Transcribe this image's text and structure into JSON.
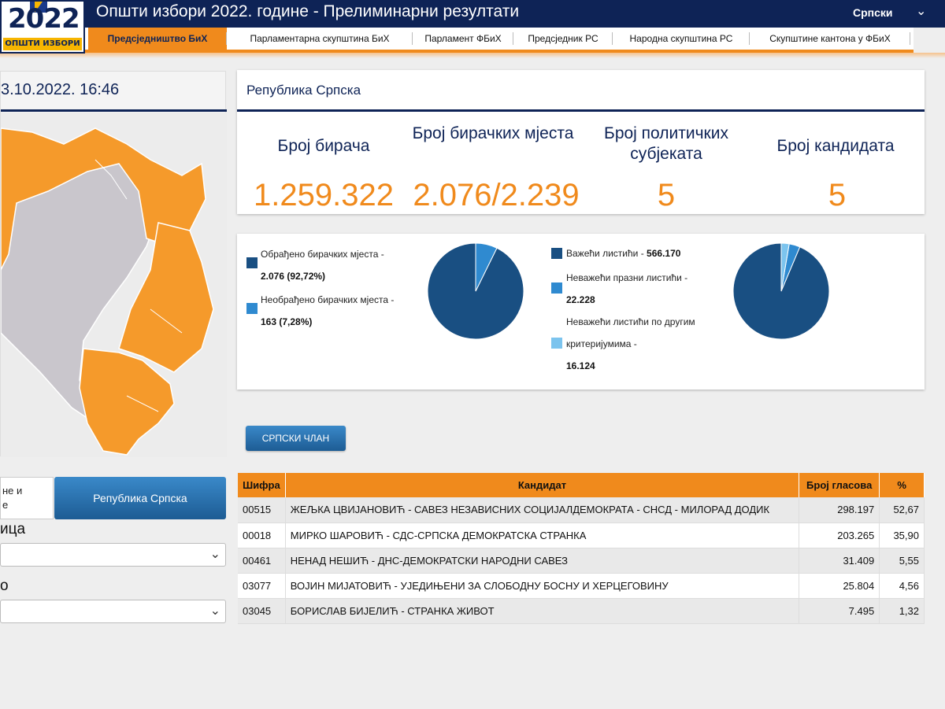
{
  "header": {
    "app_title": "Општи избори 2022. године - Прелиминарни резултати",
    "language": "Српски",
    "logo_year": "2022",
    "logo_caption": "ОПШТИ ИЗБОРИ"
  },
  "nav": {
    "tabs": [
      {
        "label": "Предсједништво БиХ"
      },
      {
        "label": "Парламентарна скупштина БиХ"
      },
      {
        "label": "Парламент ФБиХ"
      },
      {
        "label": "Предсједник РС"
      },
      {
        "label": "Народна скупштина РС"
      },
      {
        "label": "Скупштине кантона у ФБиХ"
      }
    ]
  },
  "left": {
    "datetime": "3.10.2022. 16:46",
    "entity_buttons": [
      "не и\nе",
      "Република Српска"
    ],
    "filter1_label": "ица",
    "filter2_label": "о"
  },
  "stats": {
    "title": "Република Српска",
    "items": [
      {
        "label": "Број бирача",
        "value": "1.259.322"
      },
      {
        "label": "Број бирачких мјеста",
        "value": "2.076/2.239"
      },
      {
        "label": "Број политичких субјеката",
        "value": "5"
      },
      {
        "label": "Број кандидата",
        "value": "5"
      }
    ]
  },
  "pies": {
    "left_legend": [
      {
        "text": "Обрађено бирачких мјеста -",
        "value": "2.076 (92,72%)"
      },
      {
        "text": "Необрађено бирачких мјеста -",
        "value": "163 (7,28%)"
      }
    ],
    "right_legend": [
      {
        "text": "Важећи листићи -",
        "value": "566.170"
      },
      {
        "text": "Неважећи празни листићи -",
        "value": "22.228"
      },
      {
        "text": "Неважећи листићи по другим критеријумима -",
        "value": "16.124"
      }
    ],
    "colors": {
      "dark": "#194f82",
      "mid": "#2f8ad0",
      "light": "#7cc4ee"
    }
  },
  "chart_data": [
    {
      "type": "pie",
      "categories": [
        "Обрађено бирачких мјеста",
        "Необрађено бирачких мјеста"
      ],
      "values": [
        92.72,
        7.28
      ]
    },
    {
      "type": "pie",
      "categories": [
        "Важећи листићи",
        "Неважећи празни листићи",
        "Неважећи листићи по другим критеријумима"
      ],
      "values": [
        566170,
        22228,
        16124
      ]
    }
  ],
  "member_button": "СРПСКИ ЧЛАН",
  "table": {
    "headers": [
      "Шифра",
      "Кандидат",
      "Број гласова",
      "%"
    ],
    "rows": [
      [
        "00515",
        "ЖЕЉКА ЦВИЈАНОВИЋ - САВЕЗ НЕЗАВИСНИХ СОЦИЈАЛДЕМОКРАТА - СНСД - МИЛОРАД ДОДИК",
        "298.197",
        "52,67"
      ],
      [
        "00018",
        "МИРКО ШАРОВИЋ - СДС-СРПСКА ДЕМОКРАТСКА СТРАНКА",
        "203.265",
        "35,90"
      ],
      [
        "00461",
        "НЕНАД НЕШИЋ - ДНС-ДЕМОКРАТСКИ НАРОДНИ САВЕЗ",
        "31.409",
        "5,55"
      ],
      [
        "03077",
        "ВОЈИН МИЈАТОВИЋ - УЈЕДИЊЕНИ ЗА СЛОБОДНУ БОСНУ И ХЕРЦЕГОВИНУ",
        "25.804",
        "4,56"
      ],
      [
        "03045",
        "БОРИСЛАВ БИЈЕЛИЋ - СТРАНКА ЖИВОТ",
        "7.495",
        "1,32"
      ]
    ]
  }
}
